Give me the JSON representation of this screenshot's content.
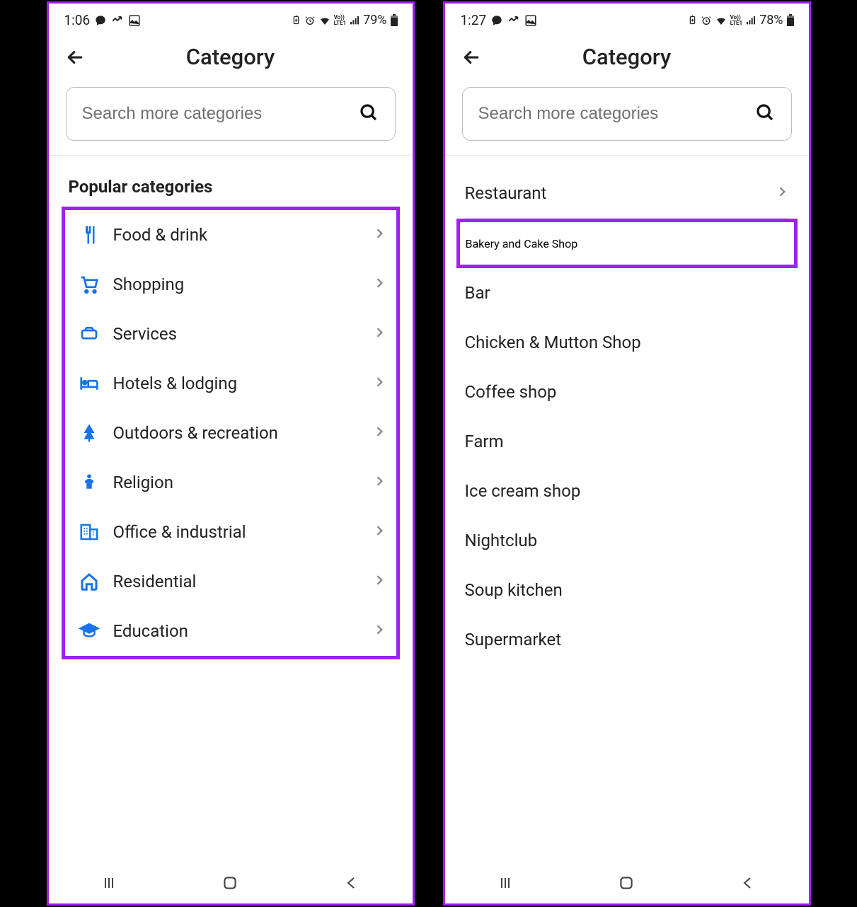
{
  "left": {
    "status": {
      "time": "1:06",
      "battery": "79%"
    },
    "title": "Category",
    "search_placeholder": "Search more categories",
    "section_heading": "Popular categories",
    "categories": [
      {
        "icon": "food",
        "label": "Food & drink"
      },
      {
        "icon": "shopping",
        "label": "Shopping"
      },
      {
        "icon": "services",
        "label": "Services"
      },
      {
        "icon": "hotels",
        "label": "Hotels & lodging"
      },
      {
        "icon": "outdoors",
        "label": "Outdoors & recreation"
      },
      {
        "icon": "religion",
        "label": "Religion"
      },
      {
        "icon": "office",
        "label": "Office & industrial"
      },
      {
        "icon": "residential",
        "label": "Residential"
      },
      {
        "icon": "education",
        "label": "Education"
      }
    ]
  },
  "right": {
    "status": {
      "time": "1:27",
      "battery": "78%"
    },
    "title": "Category",
    "search_placeholder": "Search more categories",
    "items": [
      {
        "label": "Restaurant",
        "chevron": true
      },
      {
        "label": "Bakery and Cake Shop",
        "highlighted": true
      },
      {
        "label": "Bar"
      },
      {
        "label": "Chicken & Mutton Shop"
      },
      {
        "label": "Coffee shop"
      },
      {
        "label": "Farm"
      },
      {
        "label": "Ice cream shop"
      },
      {
        "label": "Nightclub"
      },
      {
        "label": "Soup kitchen"
      },
      {
        "label": "Supermarket"
      }
    ]
  }
}
